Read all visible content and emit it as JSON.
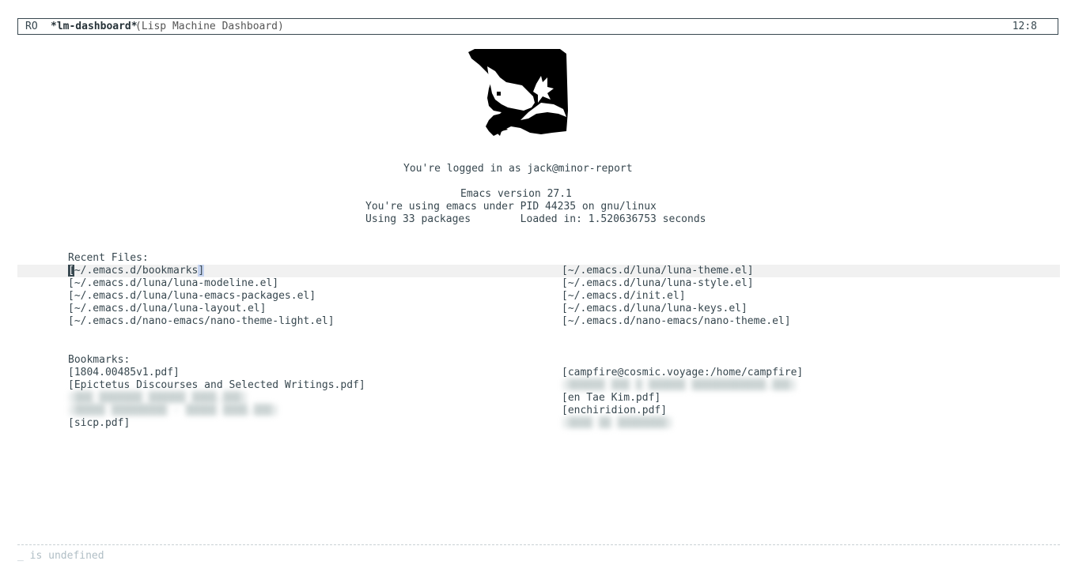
{
  "header": {
    "state": "RO",
    "buffer_name": "*lm-dashboard*",
    "mode_name": "(Lisp Machine Dashboard)",
    "position": "12:8"
  },
  "info": {
    "login": "You're logged in as jack@minor-report",
    "version": "Emacs version 27.1",
    "pid": "You're using emacs under PID 44235 on gnu/linux",
    "packages": "Using 33 packages        Loaded in: 1.520636753 seconds"
  },
  "recent_files": {
    "title": "Recent Files:",
    "left": [
      "[~/.emacs.d/bookmarks]",
      "[~/.emacs.d/luna/luna-modeline.el]",
      "[~/.emacs.d/luna/luna-emacs-packages.el]",
      "[~/.emacs.d/luna/luna-layout.el]",
      "[~/.emacs.d/nano-emacs/nano-theme-light.el]"
    ],
    "right": [
      "[~/.emacs.d/luna/luna-theme.el]",
      "[~/.emacs.d/luna/luna-style.el]",
      "[~/.emacs.d/init.el]",
      "[~/.emacs.d/luna/luna-keys.el]",
      "[~/.emacs.d/nano-emacs/nano-theme.el]"
    ]
  },
  "bookmarks": {
    "title": "Bookmarks:",
    "left": [
      "[1804.00485v1.pdf]",
      "[Epictetus Discourses and Selected Writings.pdf]",
      "[sicp.pdf]"
    ],
    "right": [
      "[campfire@cosmic.voyage:/home/campfire]",
      "[en Tae Kim.pdf]",
      "[enchiridion.pdf]"
    ]
  },
  "echo_area": "_ is undefined",
  "colors": {
    "foreground": "#37474f",
    "highlight_line": "#f1f1f1",
    "region": "#c6d4f0",
    "faded": "#b0bec5"
  }
}
